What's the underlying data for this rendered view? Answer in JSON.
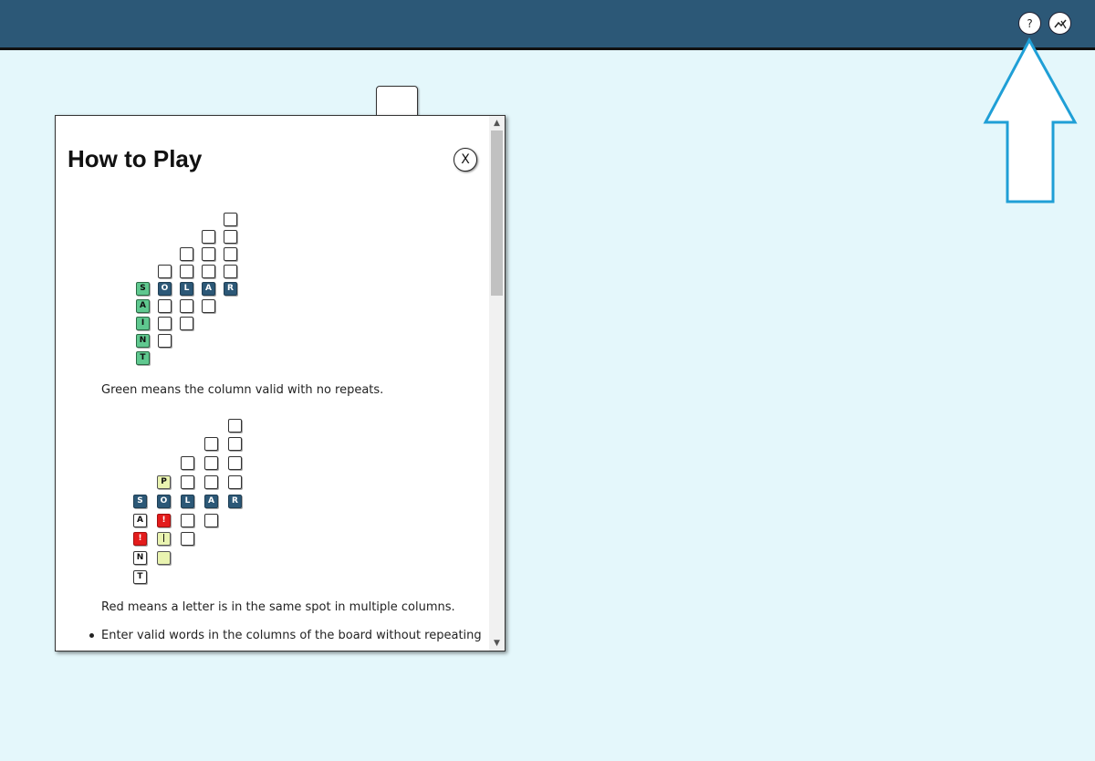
{
  "header": {
    "help_icon": "?",
    "stats_icon": "chart-icon"
  },
  "dialog": {
    "title": "How to Play",
    "close_label": "X",
    "example1": {
      "caption": "Green means the column valid with no repeats.",
      "first_column_letters": [
        "S",
        "A",
        "I",
        "N",
        "T"
      ],
      "row_letters": [
        "S",
        "O",
        "L",
        "A",
        "R"
      ]
    },
    "example2": {
      "caption": "Red means a letter is in the same spot in multiple columns.",
      "first_column_letters": [
        "S",
        "A",
        "!",
        "N",
        "T"
      ],
      "second_column_letters": [
        "P",
        "O",
        "!",
        "|",
        ""
      ],
      "row_letters": [
        "S",
        "O",
        "L",
        "A",
        "R"
      ]
    },
    "bullet": "Enter valid words in the columns of the board without repeating"
  },
  "colors": {
    "header": "#2c5877",
    "background": "#e4f7fb",
    "tile_blue": "#2c5877",
    "tile_green": "#5fc88f",
    "tile_red": "#e31c1c",
    "tile_yellow": "#e9f3b0",
    "arrow": "#1f9fd6"
  }
}
